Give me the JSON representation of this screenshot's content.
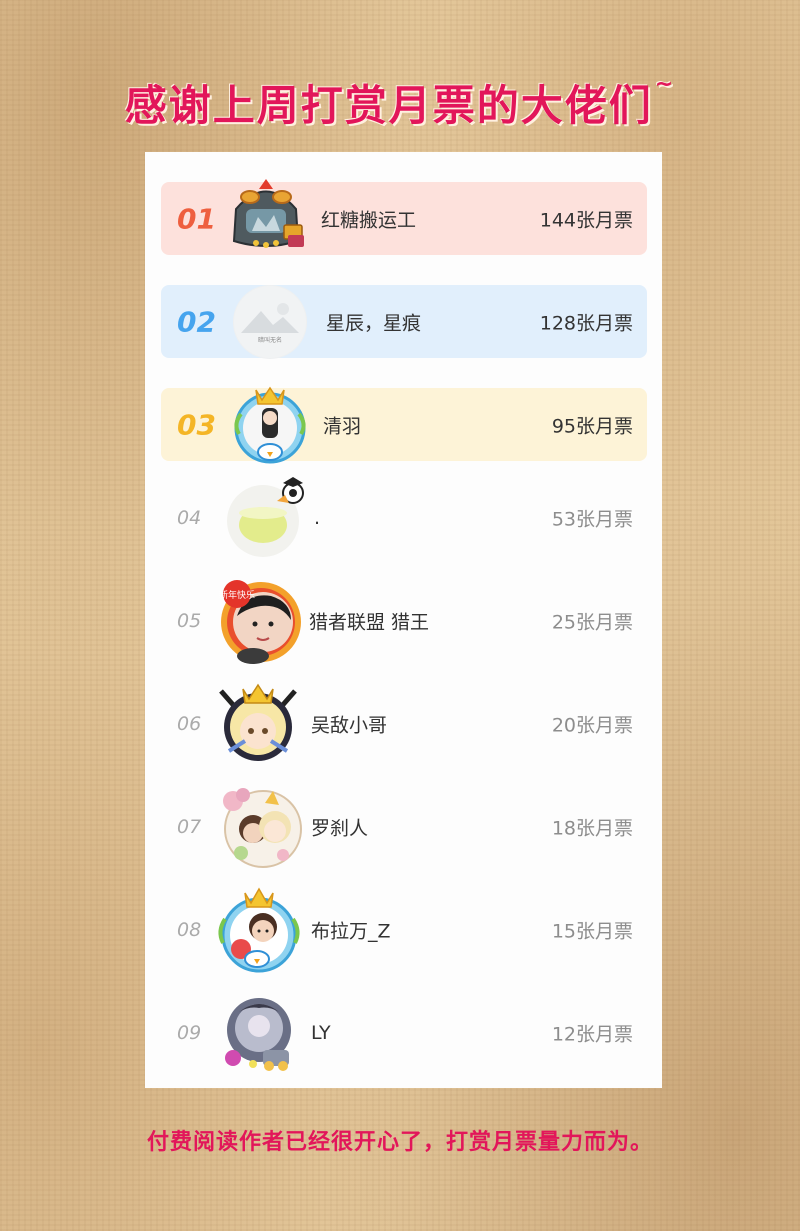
{
  "title": "感谢上周打赏月票的大佬们",
  "title_suffix": "~",
  "footer": "付费阅读作者已经很开心了，打赏月票量力而为。",
  "colors": {
    "title": "#e2165a",
    "rank1_bg": "#fde1dc",
    "rank1": "#ee5f3f",
    "rank2_bg": "#e1effc",
    "rank2": "#46a4ee",
    "rank3_bg": "#fdf3d7",
    "rank3": "#f4b526"
  },
  "ranking": [
    {
      "rank": "01",
      "name": "红糖搬运工",
      "votes": "144张月票"
    },
    {
      "rank": "02",
      "name": "星辰，星痕",
      "votes": "128张月票"
    },
    {
      "rank": "03",
      "name": "清羽",
      "votes": "95张月票"
    },
    {
      "rank": "04",
      "name": ".",
      "votes": "53张月票"
    },
    {
      "rank": "05",
      "name": "猎者联盟 猎王",
      "votes": "25张月票"
    },
    {
      "rank": "06",
      "name": "吴敌小哥",
      "votes": "20张月票"
    },
    {
      "rank": "07",
      "name": "罗刹人",
      "votes": "18张月票"
    },
    {
      "rank": "08",
      "name": "布拉万_Z",
      "votes": "15张月票"
    },
    {
      "rank": "09",
      "name": "LY",
      "votes": "12张月票"
    }
  ],
  "avatar_badges": {
    "new_year_text": "新年快乐",
    "avatar2_caption": "暗叫无名"
  }
}
